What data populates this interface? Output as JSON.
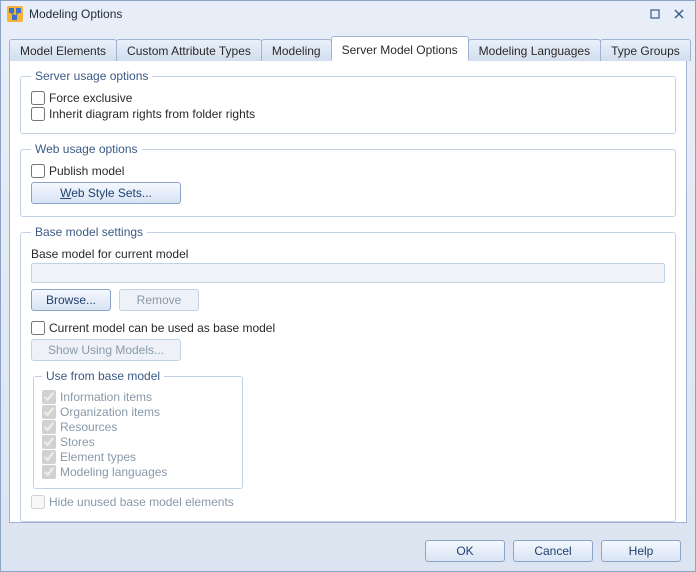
{
  "window": {
    "title": "Modeling Options"
  },
  "tabs": {
    "t0": "Model Elements",
    "t1": "Custom Attribute Types",
    "t2": "Modeling",
    "t3": "Server Model Options",
    "t4": "Modeling Languages",
    "t5": "Type Groups"
  },
  "groups": {
    "server_usage": "Server usage options",
    "web_usage": "Web usage options",
    "base_settings": "Base model settings",
    "use_from_base": "Use from base model"
  },
  "server": {
    "force_exclusive": "Force exclusive",
    "inherit_rights": "Inherit diagram rights from folder rights"
  },
  "web": {
    "publish_model": "Publish model",
    "web_style_sets_pre": "W",
    "web_style_sets_post": "eb Style Sets..."
  },
  "base": {
    "base_for_current": "Base model for current model",
    "browse": "Browse...",
    "remove": "Remove",
    "current_as_base": "Current model can be used as base model",
    "show_using_models": "Show Using Models...",
    "items": {
      "info": "Information items",
      "org": "Organization items",
      "res": "Resources",
      "stores": "Stores",
      "elem": "Element types",
      "langs": "Modeling languages"
    },
    "hide_unused": "Hide unused base model elements"
  },
  "footer": {
    "ok": "OK",
    "cancel": "Cancel",
    "help": "Help"
  }
}
